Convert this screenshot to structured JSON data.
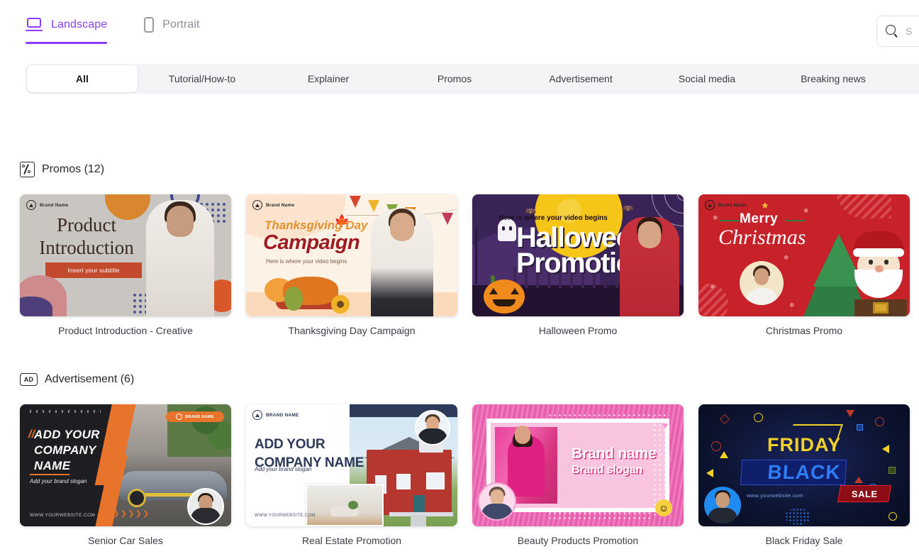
{
  "orientation_tabs": [
    {
      "label": "Landscape",
      "icon": "laptop-icon",
      "active": true
    },
    {
      "label": "Portrait",
      "icon": "phone-icon",
      "active": false
    }
  ],
  "search": {
    "placeholder": "S",
    "icon": "search-icon"
  },
  "category_tabs": [
    {
      "label": "All",
      "active": true
    },
    {
      "label": "Tutorial/How-to",
      "active": false
    },
    {
      "label": "Explainer",
      "active": false
    },
    {
      "label": "Promos",
      "active": false
    },
    {
      "label": "Advertisement",
      "active": false
    },
    {
      "label": "Social media",
      "active": false
    },
    {
      "label": "Breaking news",
      "active": false
    }
  ],
  "sections": [
    {
      "title": "Promos (12)",
      "icon": "coupon-icon",
      "cards": [
        {
          "caption": "Product Introduction - Creative",
          "brand": "Brand Name",
          "title_line1": "Product",
          "title_line2": "Introduction",
          "subtitle": "Insert your subtitle"
        },
        {
          "caption": "Thanksgiving Day Campaign",
          "brand": "Brand Name",
          "title_line1": "Thanksgiving Day",
          "title_line2": "Campaign",
          "subtitle": "Here is where your video begins"
        },
        {
          "caption": "Halloween Promo",
          "kicker": "Here is where your video begins",
          "title_line1": "Halloween",
          "title_line2": "Promotion"
        },
        {
          "caption": "Christmas Promo",
          "brand": "Brand Name",
          "title_line1": "Merry",
          "title_line2": "Christmas"
        }
      ]
    },
    {
      "title": "Advertisement (6)",
      "icon": "ad-icon",
      "cards": [
        {
          "caption": "Senior Car Sales",
          "brand": "BRAND NAME",
          "title": "ADD YOUR COMPANY NAME",
          "subtitle": "Add your brand slogan",
          "website": "WWW.YOURWEBSITE.COM"
        },
        {
          "caption": "Real Estate Promotion",
          "brand": "BRAND NAME",
          "title_line1": "ADD YOUR",
          "title_line2": "COMPANY NAME",
          "subtitle": "Add your brand slogan",
          "website": "WWW.YOURWEBSITE.COM"
        },
        {
          "caption": "Beauty Products Promotion",
          "title": "Brand name",
          "subtitle": "Brand slogan"
        },
        {
          "caption": "Black Friday Sale",
          "title_line1": "FRIDAY",
          "title_line2": "BLACK",
          "badge": "SALE",
          "website": "www.yourwebsite.com"
        }
      ]
    }
  ],
  "colors": {
    "accent": "#8B3DFF",
    "tab_strip_bg": "#f4f4f6",
    "page_bg": "#ffffff",
    "text_primary": "#26262e",
    "text_muted": "#8e8e9a"
  }
}
